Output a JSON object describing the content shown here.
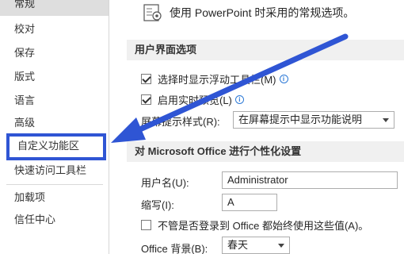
{
  "nav": {
    "items": [
      {
        "label": "常规"
      },
      {
        "label": "校对"
      },
      {
        "label": "保存"
      },
      {
        "label": "版式"
      },
      {
        "label": "语言"
      },
      {
        "label": "高级"
      },
      {
        "label": "自定义功能区"
      },
      {
        "label": "快速访问工具栏"
      },
      {
        "label": "加载项"
      },
      {
        "label": "信任中心"
      }
    ]
  },
  "intro": {
    "text": "使用 PowerPoint 时采用的常规选项。",
    "icon": "options-icon"
  },
  "ui_section": {
    "header": "用户界面选项",
    "mini_toolbar_label": "选择时显示浮动工具栏(M)",
    "mini_toolbar_checked": true,
    "live_preview_label": "启用实时预览(L)",
    "live_preview_checked": true,
    "screentip_label": "屏幕提示样式(R):",
    "screentip_value": "在屏幕提示中显示功能说明"
  },
  "personalize_section": {
    "header": "对 Microsoft Office 进行个性化设置",
    "username_label": "用户名(U):",
    "username_value": "Administrator",
    "initials_label": "缩写(I):",
    "initials_value": "A",
    "always_use_label": "不管是否登录到 Office 都始终使用这些值(A)。",
    "always_use_checked": false,
    "background_label": "Office 背景(B):",
    "background_value": "春天"
  },
  "annotation": {
    "arrow_color": "#2f55d4",
    "highlight_color": "#2f55d4"
  }
}
